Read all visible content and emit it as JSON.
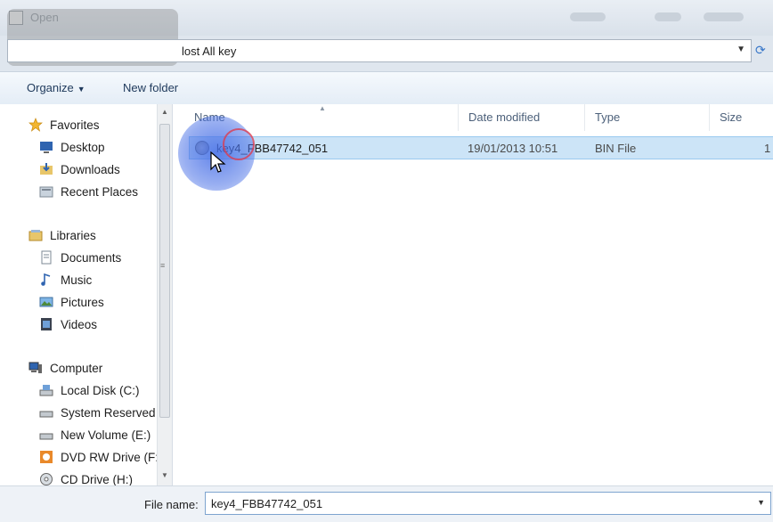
{
  "window": {
    "title": "Open"
  },
  "address": {
    "path_suffix": "lost All key"
  },
  "toolbar": {
    "organize_label": "Organize",
    "new_folder_label": "New folder"
  },
  "nav": {
    "favorites": {
      "label": "Favorites",
      "items": [
        {
          "label": "Desktop",
          "icon": "desktop-icon"
        },
        {
          "label": "Downloads",
          "icon": "downloads-icon"
        },
        {
          "label": "Recent Places",
          "icon": "recent-places-icon"
        }
      ]
    },
    "libraries": {
      "label": "Libraries",
      "items": [
        {
          "label": "Documents",
          "icon": "documents-icon"
        },
        {
          "label": "Music",
          "icon": "music-icon"
        },
        {
          "label": "Pictures",
          "icon": "pictures-icon"
        },
        {
          "label": "Videos",
          "icon": "videos-icon"
        }
      ]
    },
    "computer": {
      "label": "Computer",
      "items": [
        {
          "label": "Local Disk (C:)",
          "icon": "drive-icon"
        },
        {
          "label": "System Reserved",
          "icon": "drive-icon"
        },
        {
          "label": "New Volume (E:)",
          "icon": "drive-icon"
        },
        {
          "label": "DVD RW Drive (F:",
          "icon": "dvd-drive-icon"
        },
        {
          "label": "CD Drive (H:)",
          "icon": "cd-drive-icon"
        }
      ]
    }
  },
  "columns": {
    "name": "Name",
    "date_modified": "Date modified",
    "type": "Type",
    "size": "Size"
  },
  "files": [
    {
      "name": "key4_FBB47742_051",
      "date_modified": "19/01/2013 10:51",
      "type": "BIN File",
      "size": "1"
    }
  ],
  "footer": {
    "file_name_label": "File name:",
    "file_name_value": "key4_FBB47742_051"
  },
  "colors": {
    "selection": "#cce4f7",
    "selection_border": "#99c9ef",
    "click_highlight": "#466ee6"
  }
}
